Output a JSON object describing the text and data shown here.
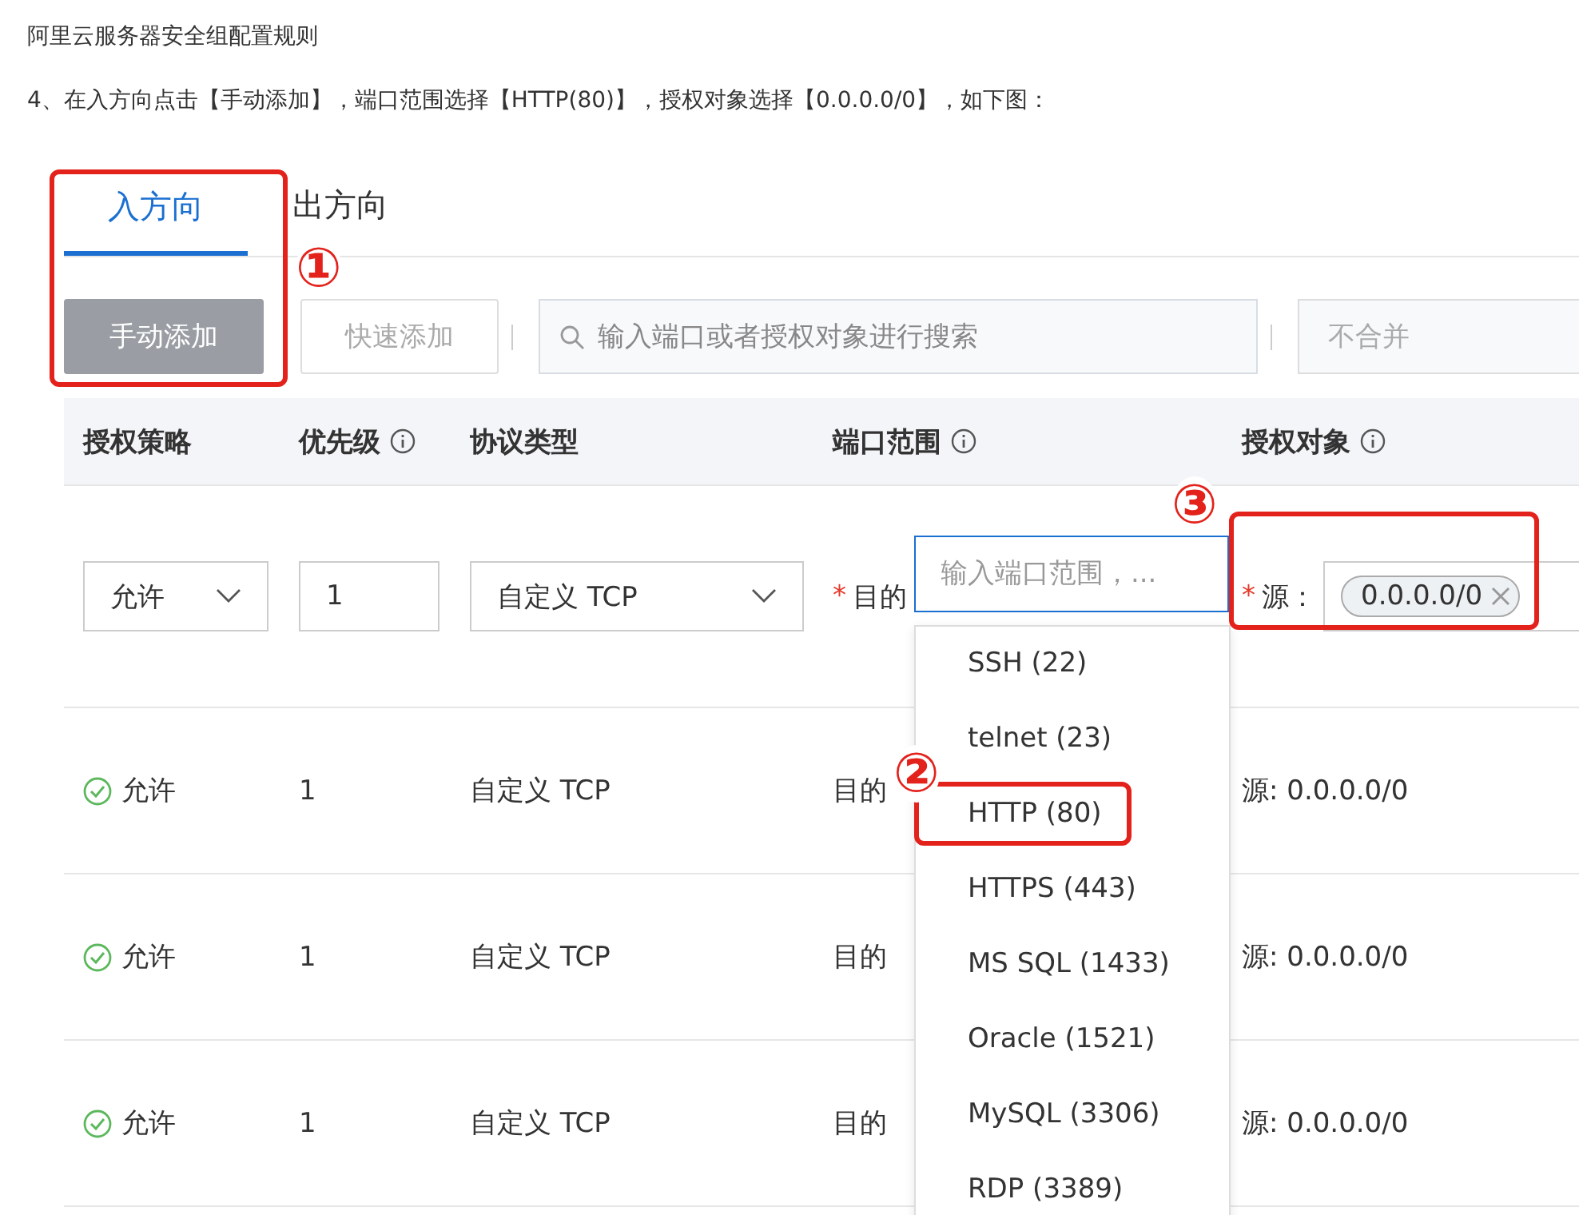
{
  "article": {
    "title": "阿里云服务器安全组配置规则",
    "step": "4、在入方向点击【手动添加】，端口范围选择【HTTP(80)】，授权对象选择【0.0.0.0/0】，如下图："
  },
  "tabs": [
    {
      "label": "入方向",
      "selected": true
    },
    {
      "label": "出方向",
      "selected": false
    }
  ],
  "toolbar": {
    "buttons": [
      {
        "label": "手动添加",
        "kind": "primary",
        "disabled": true
      },
      {
        "label": "快速添加",
        "kind": "default",
        "disabled": true
      }
    ],
    "search": {
      "placeholder": "输入端口或者授权对象进行搜索"
    },
    "merge_select": {
      "value": "不合并"
    }
  },
  "table": {
    "columns": [
      {
        "label": "授权策略",
        "info": false
      },
      {
        "label": "优先级",
        "info": true
      },
      {
        "label": "协议类型",
        "info": false
      },
      {
        "label": "端口范围",
        "info": true
      },
      {
        "label": "授权对象",
        "info": true
      }
    ],
    "edit_row": {
      "policy": "允许",
      "priority": "1",
      "protocol": "自定义 TCP",
      "required_mark": "*",
      "port_label": "目的",
      "port_placeholder": "输入端口范围，...",
      "source_label": "源：",
      "source_tag": "0.0.0.0/0"
    },
    "rows": [
      {
        "policy": "允许",
        "priority": "1",
        "protocol": "自定义 TCP",
        "port": "目的",
        "source": "源: 0.0.0.0/0"
      },
      {
        "policy": "允许",
        "priority": "1",
        "protocol": "自定义 TCP",
        "port": "目的",
        "source": "源: 0.0.0.0/0"
      },
      {
        "policy": "允许",
        "priority": "1",
        "protocol": "自定义 TCP",
        "port": "目的",
        "source": "源: 0.0.0.0/0"
      }
    ]
  },
  "port_dropdown": {
    "options": [
      "SSH (22)",
      "telnet (23)",
      "HTTP (80)",
      "HTTPS (443)",
      "MS SQL (1433)",
      "Oracle (1521)",
      "MySQL (3306)",
      "RDP (3389)"
    ]
  },
  "annotations": [
    {
      "label": "①"
    },
    {
      "label": "②"
    },
    {
      "label": "③"
    }
  ]
}
